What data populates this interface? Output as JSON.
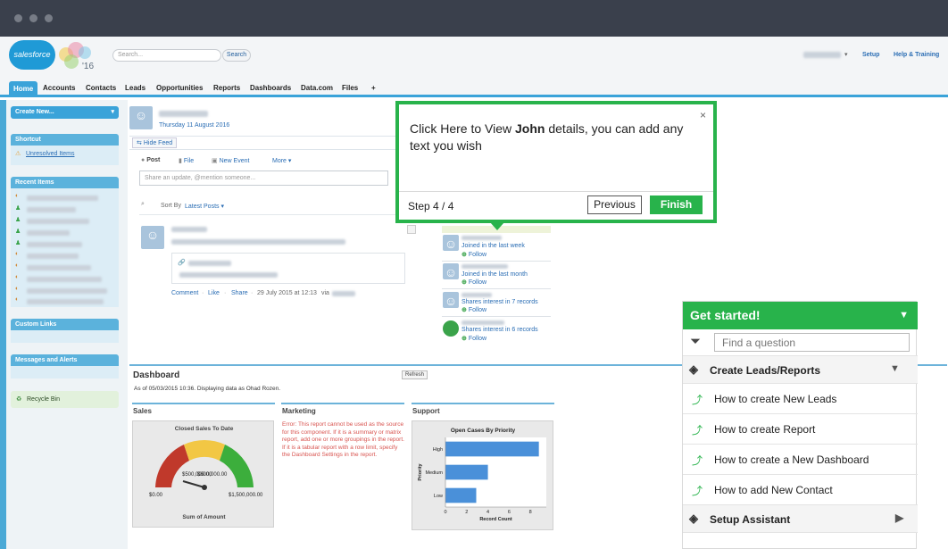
{
  "header": {
    "logo_text": "salesforce",
    "logo_year": "'16",
    "search_placeholder": "Search...",
    "search_button": "Search",
    "setup_link": "Setup",
    "help_link": "Help & Training"
  },
  "tabs": [
    "Home",
    "Accounts",
    "Contacts",
    "Leads",
    "Opportunities",
    "Reports",
    "Dashboards",
    "Data.com",
    "Files",
    "+"
  ],
  "sidebar": {
    "create_new": "Create New...",
    "shortcut_title": "Shortcut",
    "unresolved_items": "Unresolved Items",
    "recent_items_title": "Recent Items",
    "custom_links_title": "Custom Links",
    "messages_title": "Messages and Alerts",
    "recycle_bin": "Recycle Bin"
  },
  "feed": {
    "date": "Thursday 11 August 2016",
    "hide_feed": "Hide Feed",
    "post_tab": "Post",
    "file_tab": "File",
    "new_event_tab": "New Event",
    "more_tab": "More",
    "share_placeholder": "Share an update, @mention someone...",
    "sort_by": "Sort By",
    "sort_value": "Latest Posts",
    "comment": "Comment",
    "like": "Like",
    "share": "Share",
    "timestamp": "29 July 2015 at 12:13",
    "via": "via"
  },
  "people": [
    {
      "status": "Joined in the last week",
      "action": "Follow"
    },
    {
      "status": "Joined in the last month",
      "action": "Follow"
    },
    {
      "status": "Shares interest in 7 records",
      "action": "Follow"
    },
    {
      "status": "Shares interest in 6 records",
      "action": "Follow"
    }
  ],
  "tour": {
    "text_before": "Click Here to View ",
    "text_bold": "John",
    "text_after": " details, you can add any text you wish",
    "step": "Step 4 / 4",
    "previous": "Previous",
    "finish": "Finish",
    "close": "×"
  },
  "get_started": {
    "title": "Get started!",
    "search_placeholder": "Find a question",
    "section1": "Create Leads/Reports",
    "items": [
      {
        "prefix": "How to create ",
        "bold": "New Leads"
      },
      {
        "prefix": "How to create ",
        "bold": "Report"
      },
      {
        "prefix": "How to create a ",
        "bold": "New Dashboard"
      },
      {
        "prefix": "How to add ",
        "bold": "New Contact"
      }
    ],
    "section2": "Setup Assistant"
  },
  "dashboard": {
    "title": "Dashboard",
    "refresh": "Refresh",
    "as_of": "As of 05/03/2015 10:36. Displaying data as Ohad Rozen.",
    "sales_title": "Sales",
    "marketing_title": "Marketing",
    "support_title": "Support",
    "gauge_title": "Closed Sales To Date",
    "gauge_min": "$0.00",
    "gauge_max": "$1,500,000.00",
    "gauge_mid": "$500,000.00",
    "gauge_value": "$600,000.00",
    "gauge_footer": "Sum of Amount",
    "marketing_error": "Error: This report cannot be used as the source for this component. If it is a summary or matrix report, add one or more groupings in the report. If it is a tabular report with a row limit, specify the Dashboard Settings in the report.",
    "colors": {
      "accent": "#28b34b",
      "bar": "#4a90d9",
      "gauge_red": "#c0392b",
      "gauge_yellow": "#f2c744",
      "gauge_green": "#3cae3c"
    }
  },
  "chart_data": {
    "type": "bar",
    "title": "Open Cases By Priority",
    "categories": [
      "High",
      "Medium",
      "Low"
    ],
    "values": [
      8.8,
      4.0,
      2.9
    ],
    "xlabel": "Record Count",
    "ylabel": "Priority",
    "xticks": [
      "0",
      "2",
      "4",
      "6",
      "8"
    ],
    "xlim": [
      0,
      9.5
    ],
    "orientation": "horizontal"
  }
}
